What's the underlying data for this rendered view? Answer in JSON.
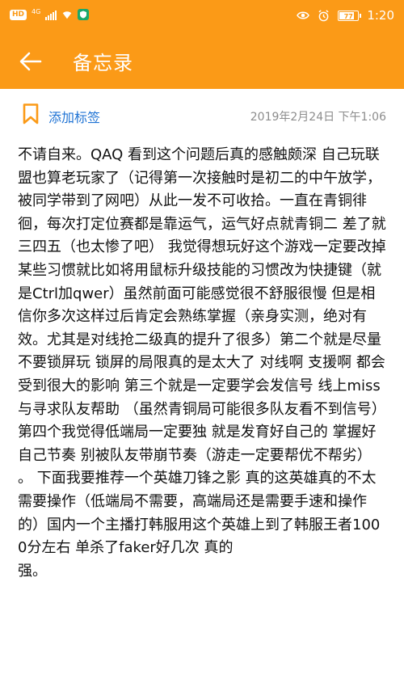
{
  "status_bar": {
    "network_badge": "HD",
    "network_type": "4G",
    "battery_level": "77",
    "time": "1:20",
    "icons": [
      "hd-icon",
      "signal-icon",
      "wifi-icon",
      "security-shield-icon",
      "eye-icon",
      "alarm-icon",
      "battery-icon"
    ],
    "colors": {
      "bar": "#fb9a17",
      "shield": "#19a86c"
    }
  },
  "app_bar": {
    "title": "备忘录",
    "back_icon": "arrow-left-icon"
  },
  "meta": {
    "add_tag_label": "添加标签",
    "timestamp": "2019年2月24日 下午1:06",
    "tag_icon": "bookmark-icon",
    "link_color": "#1f73d4"
  },
  "note": {
    "body": "不请自来。QAQ  看到这个问题后真的感触颇深 自己玩联盟也算老玩家了（记得第一次接触时是初二的中午放学，被同学带到了网吧）从此一发不可收拾。一直在青铜徘徊，每次打定位赛都是靠运气，运气好点就青铜二 差了就三四五（也太惨了吧）  我觉得想玩好这个游戏一定要改掉某些习惯就比如将用鼠标升级技能的习惯改为快捷键（就是Ctrl加qwer）虽然前面可能感觉很不舒服很慢  但是相信你多次这样过后肯定会熟练掌握（亲身实测，绝对有效。尤其是对线抢二级真的提升了很多）第二个就是尽量不要锁屏玩 锁屏的局限真的是太大了  对线啊  支援啊 都会受到很大的影响  第三个就是一定要学会发信号 线上miss  与寻求队友帮助  （虽然青铜局可能很多队友看不到信号）  第四个我觉得低端局一定要独 就是发育好自己的  掌握好自己节奏  别被队友带崩节奏（游走一定要帮优不帮劣）  。 下面我要推荐一个英雄刀锋之影 真的这英雄真的不太需要操作（低端局不需要，高端局还是需要手速和操作的）国内一个主播打韩服用这个英雄上到了韩服王者1000分左右  单杀了faker好几次  真的",
    "body_tail": "强。"
  }
}
